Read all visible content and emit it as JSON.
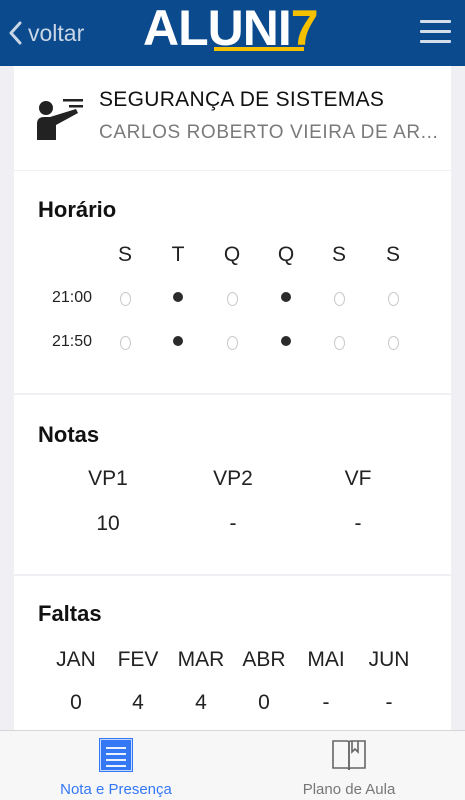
{
  "header": {
    "back_label": "voltar",
    "logo_main": "ALUNI",
    "logo_num": "7",
    "brand_color": "#0b4a8c",
    "accent_color": "#f4c000"
  },
  "course": {
    "title": "SEGURANÇA DE SISTEMAS",
    "teacher": "CARLOS ROBERTO VIEIRA DE AR..."
  },
  "schedule": {
    "title": "Horário",
    "days": [
      "S",
      "T",
      "Q",
      "Q",
      "S",
      "S"
    ],
    "rows": [
      {
        "time": "21:00",
        "slots": [
          false,
          true,
          false,
          true,
          false,
          false
        ]
      },
      {
        "time": "21:50",
        "slots": [
          false,
          true,
          false,
          true,
          false,
          false
        ]
      }
    ]
  },
  "grades": {
    "title": "Notas",
    "headers": [
      "VP1",
      "VP2",
      "VF"
    ],
    "values": [
      "10",
      "-",
      "-"
    ]
  },
  "absences": {
    "title": "Faltas",
    "months": [
      "JAN",
      "FEV",
      "MAR",
      "ABR",
      "MAI",
      "JUN"
    ],
    "values": [
      "0",
      "4",
      "4",
      "0",
      "-",
      "-"
    ]
  },
  "tabs": [
    {
      "label": "Nota e Presença",
      "icon": "list-icon",
      "active": true,
      "color": "#3478f6"
    },
    {
      "label": "Plano de Aula",
      "icon": "book-icon",
      "active": false,
      "color": "#777777"
    }
  ]
}
